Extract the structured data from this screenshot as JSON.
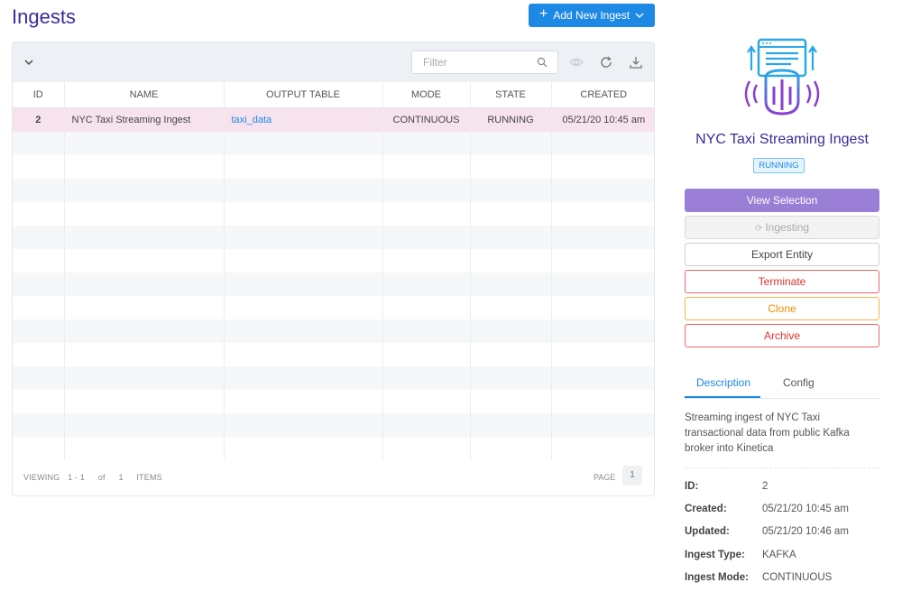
{
  "page": {
    "title": "Ingests"
  },
  "header": {
    "add_button_label": "Add New Ingest"
  },
  "toolbar": {
    "filter_placeholder": "Filter"
  },
  "table": {
    "columns": [
      "ID",
      "NAME",
      "OUTPUT TABLE",
      "MODE",
      "STATE",
      "CREATED"
    ],
    "rows": [
      {
        "id": "2",
        "name": "NYC Taxi Streaming Ingest",
        "output_table": "taxi_data",
        "mode": "CONTINUOUS",
        "state": "RUNNING",
        "created": "05/21/20 10:45 am"
      }
    ],
    "empty_row_count": 14
  },
  "footer": {
    "viewing_label": "VIEWING",
    "range": "1 - 1",
    "of_label": "of",
    "total": "1",
    "items_label": "ITEMS",
    "page_label": "PAGE",
    "page_number": "1"
  },
  "detail": {
    "title": "NYC Taxi Streaming Ingest",
    "status": "RUNNING",
    "buttons": {
      "view_selection": "View Selection",
      "ingesting": "Ingesting",
      "export": "Export Entity",
      "terminate": "Terminate",
      "clone": "Clone",
      "archive": "Archive"
    },
    "tabs": {
      "description": "Description",
      "config": "Config"
    },
    "description": "Streaming ingest of NYC Taxi transactional data from public Kafka broker into Kinetica",
    "fields": [
      {
        "label": "ID:",
        "value": "2"
      },
      {
        "label": "Created:",
        "value": "05/21/20 10:45 am"
      },
      {
        "label": "Updated:",
        "value": "05/21/20 10:46 am"
      },
      {
        "label": "Ingest Type:",
        "value": "KAFKA"
      },
      {
        "label": "Ingest Mode:",
        "value": "CONTINUOUS"
      }
    ]
  },
  "colors": {
    "title": "#3d2a9a",
    "primary": "#1e88e5",
    "view_button": "#9b7fd6",
    "danger": "#e03131",
    "warning": "#f08c00",
    "selected_row": "#f7e3ee"
  }
}
